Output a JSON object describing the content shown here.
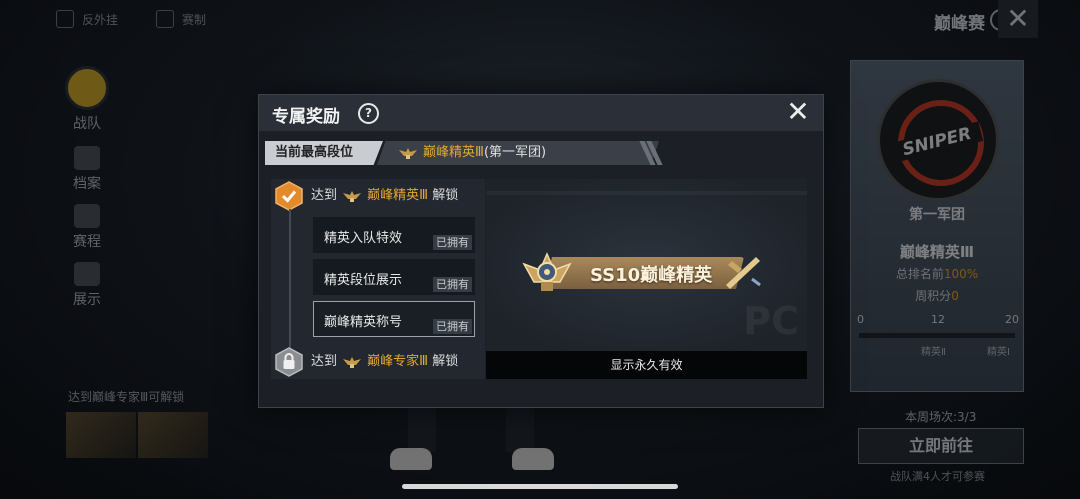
{
  "background": {
    "topbar": {
      "tab1": "反外挂",
      "tab2": "赛制",
      "title": "巅峰赛",
      "help_glyph": "?",
      "close_glyph": "✕"
    },
    "sidebar": [
      {
        "label": "战队",
        "icon": "team-emblem-icon"
      },
      {
        "label": "档案",
        "icon": "archive-icon"
      },
      {
        "label": "赛程",
        "icon": "calendar-icon"
      },
      {
        "label": "展示",
        "icon": "gear-icon"
      }
    ],
    "left_note": "达到巅峰专家Ⅲ可解锁",
    "right_panel": {
      "logo_text": "SNIPER",
      "legion": "第一军团",
      "rank": "巅峰精英Ⅲ",
      "rank_line_prefix": "总排名前",
      "rank_pct": "100%",
      "points_prefix": "周积分",
      "points": "0",
      "scale": [
        "0",
        "12",
        "20"
      ],
      "scale_sub": [
        "精英Ⅱ",
        "精英Ⅰ"
      ],
      "week_label": "本周场次:3/3",
      "go_button": "立即前往",
      "go_hint": "战队满4人才可参赛"
    }
  },
  "modal": {
    "title": "专属奖励",
    "help_glyph": "?",
    "close_glyph": "✕",
    "current_rank_label": "当前最高段位",
    "current_rank_value": "巅峰精英Ⅲ",
    "current_rank_suffix": "(第一军团)",
    "tiers": [
      {
        "prefix": "达到",
        "rank": "巅峰精英Ⅲ",
        "suffix": "解锁",
        "state": "unlocked"
      },
      {
        "prefix": "达到",
        "rank": "巅峰专家Ⅲ",
        "suffix": "解锁",
        "state": "locked"
      }
    ],
    "rewards": [
      {
        "name": "精英入队特效",
        "status": "已拥有"
      },
      {
        "name": "精英段位展示",
        "status": "已拥有"
      },
      {
        "name": "巅峰精英称号",
        "status": "已拥有"
      }
    ],
    "preview_title": "SS10巅峰精英",
    "preview_watermark": "PC",
    "footer": "显示永久有效",
    "colors": {
      "gold": "#e3a734",
      "badge_orange": "#e38a2b"
    }
  }
}
